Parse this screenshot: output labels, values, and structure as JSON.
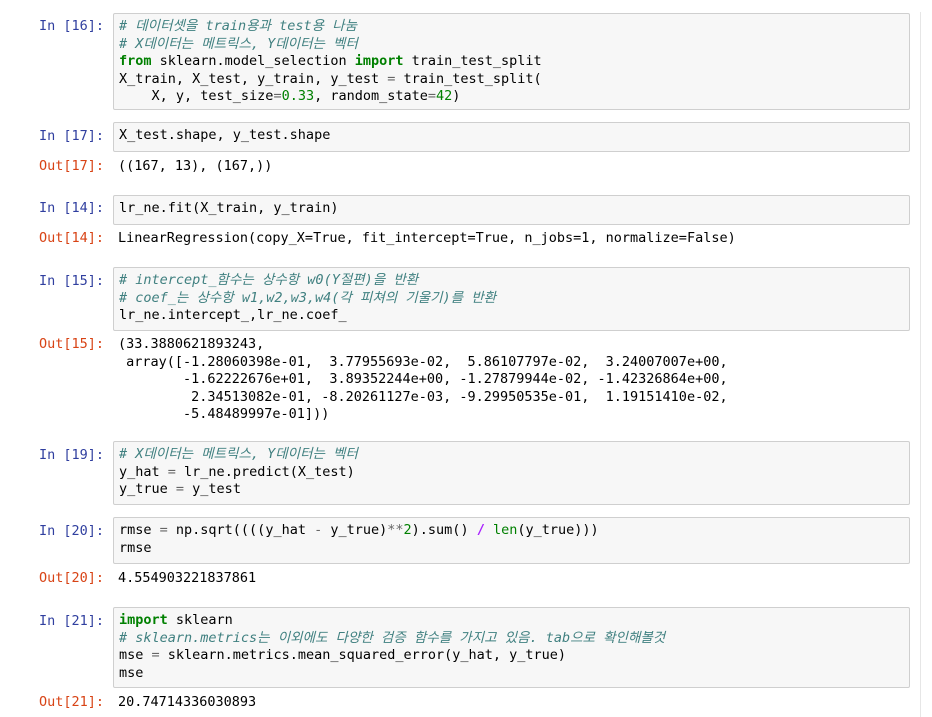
{
  "cells": [
    {
      "in_prompt": "In [16]:",
      "lines": [
        [
          {
            "t": "# 데이터셋을 train용과 test용 나눔",
            "c": "cm"
          }
        ],
        [
          {
            "t": "# X데이터는 메트릭스, Y데이터는 벡터",
            "c": "cm"
          }
        ],
        [
          {
            "t": "from",
            "c": "kw"
          },
          {
            "t": " sklearn.model_selection "
          },
          {
            "t": "import",
            "c": "kw"
          },
          {
            "t": " train_test_split"
          }
        ],
        [
          {
            "t": "X_train, X_test, y_train, y_test "
          },
          {
            "t": "=",
            "c": "opn"
          },
          {
            "t": " train_test_split("
          }
        ],
        [
          {
            "t": "    X, y, test_size"
          },
          {
            "t": "=",
            "c": "opn"
          },
          {
            "t": "0.33",
            "c": "num"
          },
          {
            "t": ", random_state"
          },
          {
            "t": "=",
            "c": "opn"
          },
          {
            "t": "42",
            "c": "num"
          },
          {
            "t": ")"
          }
        ]
      ]
    },
    {
      "in_prompt": "In [17]:",
      "lines": [
        [
          {
            "t": "X_test.shape, y_test.shape"
          }
        ]
      ],
      "out_prompt": "Out[17]:",
      "output": "((167, 13), (167,))"
    },
    {
      "in_prompt": "In [14]:",
      "lines": [
        [
          {
            "t": "lr_ne.fit(X_train, y_train)"
          }
        ]
      ],
      "out_prompt": "Out[14]:",
      "output": "LinearRegression(copy_X=True, fit_intercept=True, n_jobs=1, normalize=False)"
    },
    {
      "in_prompt": "In [15]:",
      "lines": [
        [
          {
            "t": "# intercept_함수는 상수항 w0(Y절편)을 반환",
            "c": "cm"
          }
        ],
        [
          {
            "t": "# coef_는 상수항 w1,w2,w3,w4(각 피쳐의 기울기)를 반환",
            "c": "cm"
          }
        ],
        [
          {
            "t": "lr_ne.intercept_,lr_ne.coef_"
          }
        ]
      ],
      "out_prompt": "Out[15]:",
      "output": "(33.3880621893243,\n array([-1.28060398e-01,  3.77955693e-02,  5.86107797e-02,  3.24007007e+00,\n        -1.62222676e+01,  3.89352244e+00, -1.27879944e-02, -1.42326864e+00,\n         2.34513082e-01, -8.20261127e-03, -9.29950535e-01,  1.19151410e-02,\n        -5.48489997e-01]))"
    },
    {
      "in_prompt": "In [19]:",
      "lines": [
        [
          {
            "t": "# X데이터는 메트릭스, Y데이터는 벡터",
            "c": "cm"
          }
        ],
        [
          {
            "t": "y_hat "
          },
          {
            "t": "=",
            "c": "opn"
          },
          {
            "t": " lr_ne.predict(X_test)"
          }
        ],
        [
          {
            "t": "y_true "
          },
          {
            "t": "=",
            "c": "opn"
          },
          {
            "t": " y_test"
          }
        ]
      ]
    },
    {
      "in_prompt": "In [20]:",
      "lines": [
        [
          {
            "t": "rmse "
          },
          {
            "t": "=",
            "c": "opn"
          },
          {
            "t": " np.sqrt((((y_hat "
          },
          {
            "t": "-",
            "c": "opn"
          },
          {
            "t": " y_true)"
          },
          {
            "t": "**",
            "c": "opn"
          },
          {
            "t": "2",
            "c": "num"
          },
          {
            "t": ").sum() "
          },
          {
            "t": "/",
            "c": "op"
          },
          {
            "t": " "
          },
          {
            "t": "len",
            "c": "bi"
          },
          {
            "t": "(y_true)))"
          }
        ],
        [
          {
            "t": "rmse"
          }
        ]
      ],
      "out_prompt": "Out[20]:",
      "output": "4.554903221837861"
    },
    {
      "in_prompt": "In [21]:",
      "lines": [
        [
          {
            "t": "import",
            "c": "kw"
          },
          {
            "t": " sklearn"
          }
        ],
        [
          {
            "t": "# sklearn.metrics는 이외에도 다양한 검증 함수를 가지고 있음. tab으로 확인해볼것",
            "c": "cm"
          }
        ],
        [
          {
            "t": "mse "
          },
          {
            "t": "=",
            "c": "opn"
          },
          {
            "t": " sklearn.metrics.mean_squared_error(y_hat, y_true)"
          }
        ],
        [
          {
            "t": "mse"
          }
        ]
      ],
      "out_prompt": "Out[21]:",
      "output": "20.74714336030893"
    }
  ]
}
